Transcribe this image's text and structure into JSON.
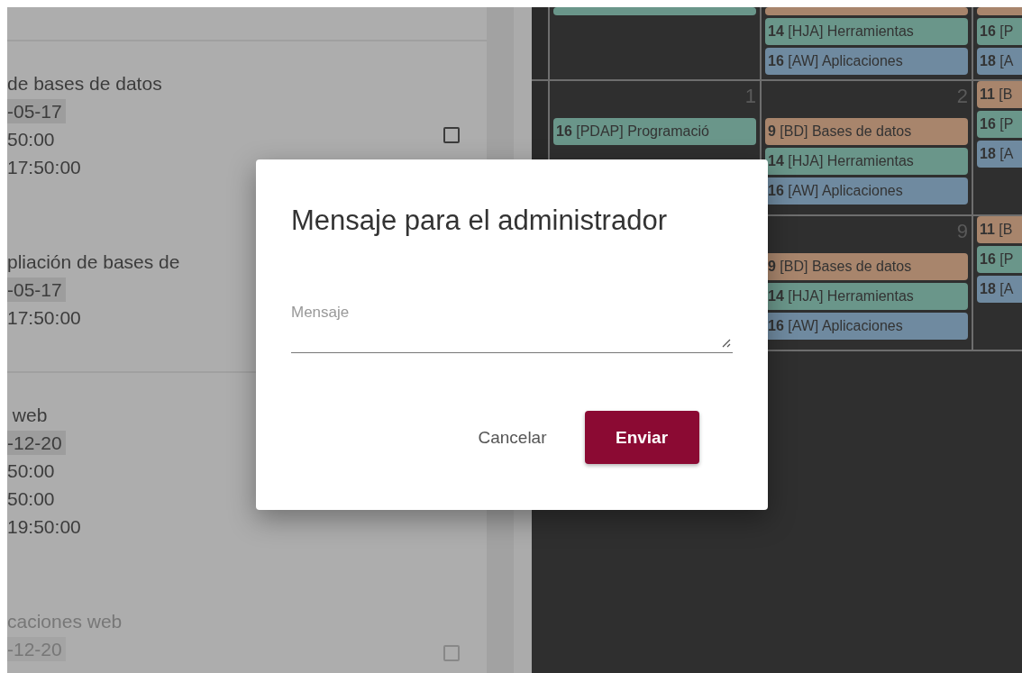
{
  "list_panel": {
    "groups": [
      {
        "items": [
          {
            "title": "de bases de datos",
            "date": "-05-17",
            "times": [
              "50:00",
              "17:50:00"
            ],
            "disabled": false,
            "checked": false
          },
          {
            "title": "pliación de bases de",
            "date": "-05-17",
            "times": [
              "17:50:00"
            ],
            "disabled": false
          }
        ]
      },
      {
        "items": [
          {
            "title": " web",
            "date": "-12-20",
            "times": [
              "50:00",
              "50:00",
              "19:50:00"
            ],
            "disabled": false
          },
          {
            "title": "caciones web",
            "date": "-12-20",
            "disabled": true,
            "checked": false
          }
        ]
      }
    ]
  },
  "calendar": {
    "weeks": [
      {
        "days": [
          {
            "events": [
              {
                "color": "#6a968a"
              }
            ]
          },
          {
            "events": [
              {
                "color": "#a8856c"
              },
              {
                "text": "**14** [HJA] Herramientas",
                "color": "#6a968a"
              },
              {
                "text": "**16** [AW] Aplicaciones",
                "color": "#6f8aa0"
              }
            ]
          },
          {
            "events": [
              {
                "color": "#a8856c"
              },
              {
                "text": "**16** [P",
                "color": "#6a968a"
              },
              {
                "text": "**18** [A",
                "color": "#6f8aa0"
              }
            ]
          }
        ]
      },
      {
        "days": [
          {
            "number": "1",
            "events": [
              {
                "text": "**16** [PDAP] Programació",
                "color": "#6a968a"
              }
            ]
          },
          {
            "number": "2",
            "events": [
              {
                "text": "**9** [BD] Bases de datos",
                "color": "#a8856c"
              },
              {
                "text": "**14** [HJA] Herramientas",
                "color": "#6a968a"
              },
              {
                "text": "**16** [AW] Aplicaciones",
                "color": "#6f8aa0"
              }
            ]
          },
          {
            "events": [
              {
                "text": "**11** [B",
                "color": "#a8856c"
              },
              {
                "text": "**16** [P",
                "color": "#6a968a"
              },
              {
                "text": "**18** [A",
                "color": "#6f8aa0"
              }
            ]
          }
        ]
      },
      {
        "days": [
          {
            "number": "9",
            "events": [
              {
                "text": "**9** [BD] Bases de datos",
                "color": "#a8856c"
              },
              {
                "text": "**14** [HJA] Herramientas",
                "color": "#6a968a"
              },
              {
                "text": "**16** [AW] Aplicaciones",
                "color": "#6f8aa0"
              }
            ]
          },
          {
            "events": [
              {
                "text": "**11** [B",
                "color": "#a8856c"
              },
              {
                "text": "**16** [P",
                "color": "#6a968a"
              },
              {
                "text": "**18** [A",
                "color": "#6f8aa0"
              }
            ]
          }
        ]
      }
    ]
  },
  "dialog": {
    "title": "Mensaje para el administrador",
    "field": {
      "placeholder": "Mensaje"
    },
    "buttons": [
      {
        "label": "Cancelar",
        "kind": "text"
      },
      {
        "label": "Enviar",
        "kind": "primary"
      }
    ]
  }
}
